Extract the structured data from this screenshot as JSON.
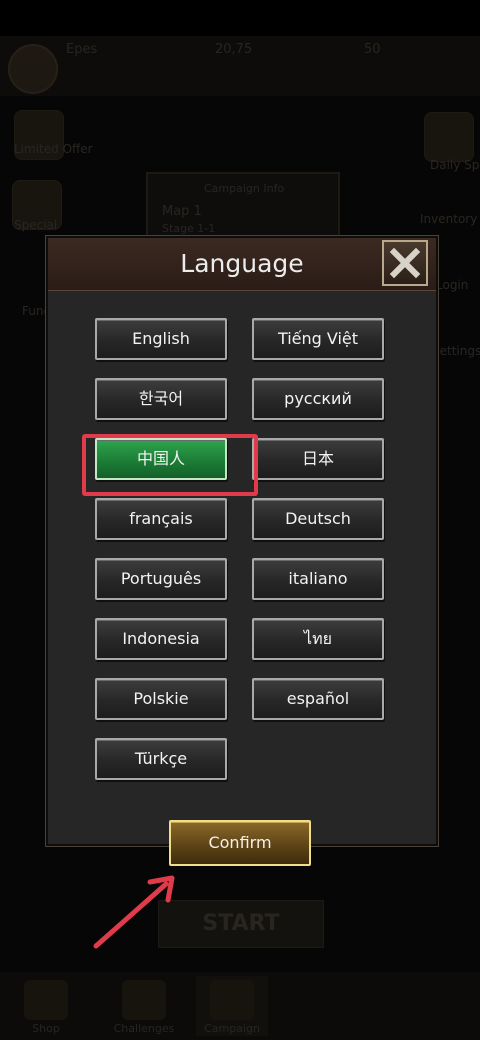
{
  "background": {
    "player_name": "Epes",
    "resource_1": "20,75",
    "resource_2": "50",
    "campaign_info_title": "Campaign Info",
    "campaign_map": "Map 1",
    "campaign_stage": "Stage 1-1",
    "side_left": [
      "Limited Offer",
      "Special",
      "Funds Bundle"
    ],
    "side_right": [
      "Daily Spin",
      "Inventory",
      "Login",
      "Settings"
    ],
    "start_label": "START",
    "bottom_nav": [
      "Shop",
      "Challenges",
      "Campaign",
      ""
    ]
  },
  "dialog": {
    "title": "Language",
    "close_icon": "close-x-icon",
    "languages": [
      [
        "English",
        "Tiếng Việt"
      ],
      [
        "한국어",
        "русский"
      ],
      [
        "中国人",
        "日本"
      ],
      [
        "français",
        "Deutsch"
      ],
      [
        "Português",
        "italiano"
      ],
      [
        "Indonesia",
        "ไทย"
      ],
      [
        "Polskie",
        "español"
      ],
      [
        "Türkçe"
      ]
    ],
    "selected": "中国人",
    "confirm_label": "Confirm"
  },
  "colors": {
    "selected_green": "#1f8b3c",
    "highlight_red": "#e03b4b",
    "confirm_gold": "#6a4c1c",
    "dialog_bg": "#262626",
    "header_brown": "#33241c"
  }
}
